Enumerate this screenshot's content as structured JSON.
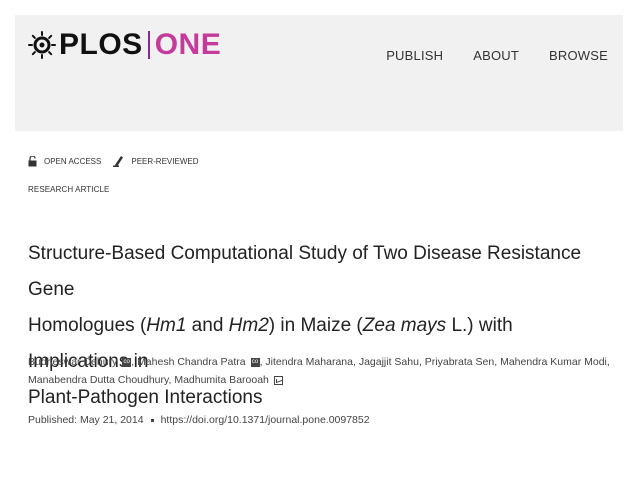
{
  "header": {
    "logo_plos": "PLOS",
    "logo_one": "ONE",
    "nav": [
      "PUBLISH",
      "ABOUT",
      "BROWSE"
    ]
  },
  "badges": {
    "open_access": "OPEN ACCESS",
    "peer_reviewed": "PEER-REVIEWED"
  },
  "article": {
    "type": "RESEARCH ARTICLE",
    "title_line1": "Structure-Based Computational Study of Two Disease Resistance Gene",
    "title_l2a": "Homologues (",
    "title_l2_hm1": "Hm1",
    "title_l2b": " and ",
    "title_l2_hm2": "Hm2",
    "title_l2c": ") in Maize (",
    "title_l2_species": "Zea mays",
    "title_l2d": " L.) with Implications in",
    "title_line3": "Plant-Pathogen Interactions",
    "authors": [
      "Budheswar Dehury",
      "Mahesh Chandra Patra",
      "Jitendra Maharana",
      "Jagajjit Sahu",
      "Priyabrata Sen",
      "Mahendra Kumar Modi",
      "Manabendra Dutta Choudhury",
      "Madhumita Barooah"
    ],
    "contrib_icon": "co",
    "published": "Published: May 21, 2014",
    "doi": "https://doi.org/10.1371/journal.pone.0097852"
  },
  "colors": {
    "brand_one": "#c43b9b",
    "header_bg": "#f1f1f1"
  }
}
